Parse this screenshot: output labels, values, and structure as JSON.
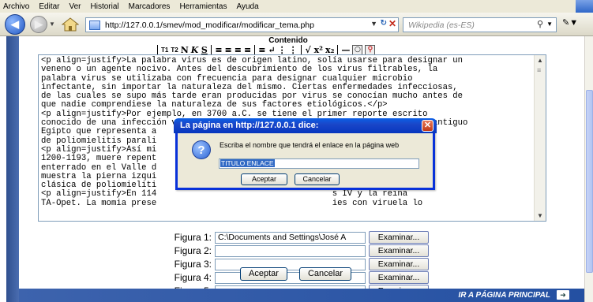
{
  "menu": [
    "Archivo",
    "Editar",
    "Ver",
    "Historial",
    "Marcadores",
    "Herramientas",
    "Ayuda"
  ],
  "nav": {
    "url": "http://127.0.0.1/smev/mod_modificar/modificar_tema.php",
    "search_placeholder": "Wikipedia (es-ES)"
  },
  "editor": {
    "section_title": "Contenido",
    "toolbar": {
      "t1": "T1",
      "t2": "T2",
      "n": "N",
      "k": "K",
      "s": "S",
      "sup": "x²",
      "sub": "x₂"
    },
    "lines": [
      "<p align=justify>La palabra virus es de origen latino, solía usarse para designar un",
      "veneno o un agente nocivo. Antes del descubrimiento de los virus filtrables, la",
      "palabra virus se utilizaba con frecuencia para designar cualquier microbio",
      "infectante, sin importar la naturaleza del mismo. Ciertas enfermedades infecciosas,",
      "de las cuales se supo más tarde eran producidas por virus se conocían mucho antes de",
      "que nadie comprendiese la naturaleza de sus factores etiológicos.</p>",
      "<p align=justify>Por ejemplo, en 3700 a.C. se tiene el primer reporte escrito",
      "conocido de una infección viral, un jeroglífico hecho en Memphis, capital del antiguo",
      "Egipto que representa a                                    s clínicos típicos",
      "de poliomielitis parali                                   blación.</p>",
      "<p align=justify>Así mi                                   rna Egipto de",
      "1200-1193, muere repent                                   e momificado y",
      "enterrado en el Valle d                                   excavada. La momia",
      "muestra la pierna izqui                                   ndido, lesión",
      "clásica de poliomieliti",
      "<p align=justify>En 114                                   s IV y la reina",
      "TA-Opet. La momia prese                                   ies con viruela lo"
    ]
  },
  "figures": [
    {
      "label": "Figura 1:",
      "value": "C:\\Documents and Settings\\José A",
      "button": "Examinar..."
    },
    {
      "label": "Figura 2:",
      "value": "",
      "button": "Examinar..."
    },
    {
      "label": "Figura 3:",
      "value": "",
      "button": "Examinar..."
    },
    {
      "label": "Figura 4:",
      "value": "",
      "button": "Examinar..."
    },
    {
      "label": "Figura 5:",
      "value": "",
      "button": "Examinar..."
    }
  ],
  "form": {
    "accept": "Aceptar",
    "cancel": "Cancelar"
  },
  "footer": {
    "link": "IR A PÁGINA PRINCIPAL"
  },
  "dialog": {
    "title": "La página en http://127.0.0.1 dice:",
    "message": "Escriba el nombre que tendrá el enlace en la página web",
    "input_value": "TITULO ENLACE",
    "ok": "Aceptar",
    "cancel": "Cancelar"
  },
  "colors": {
    "dialog_title": "#0a5fe6",
    "footer_bar": "#2450a2",
    "selection": "#316ac5"
  }
}
